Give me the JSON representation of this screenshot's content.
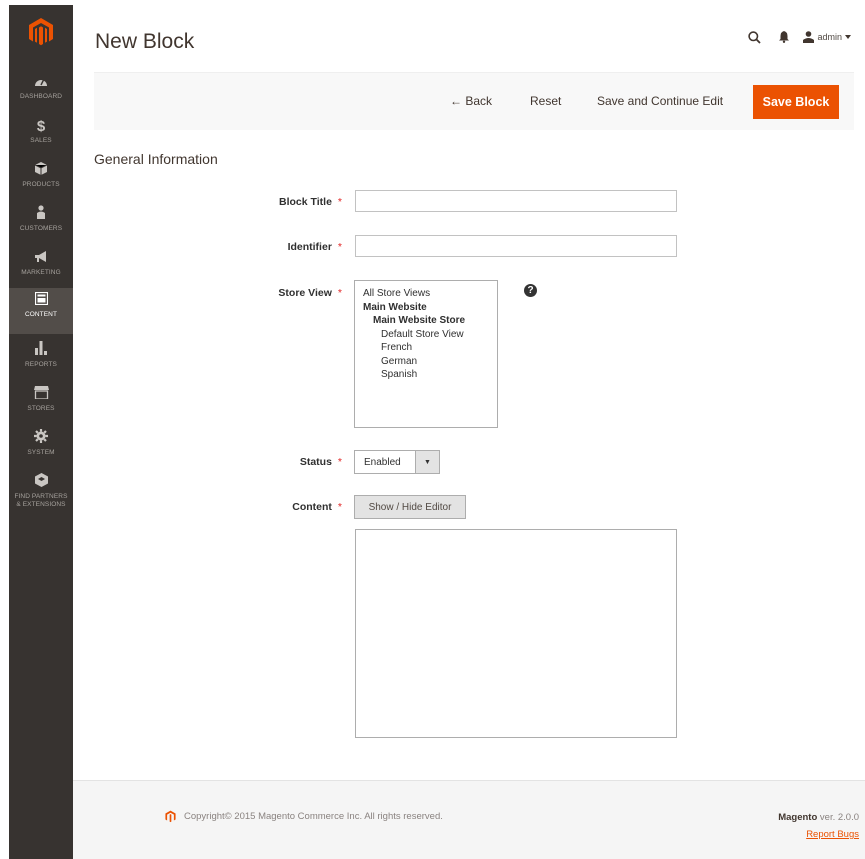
{
  "header": {
    "page_title": "New Block",
    "admin_user": "admin"
  },
  "sidebar": {
    "items": [
      {
        "label": "DASHBOARD",
        "icon": "dashboard-icon"
      },
      {
        "label": "SALES",
        "icon": "dollar-icon"
      },
      {
        "label": "PRODUCTS",
        "icon": "box-icon"
      },
      {
        "label": "CUSTOMERS",
        "icon": "person-icon"
      },
      {
        "label": "MARKETING",
        "icon": "megaphone-icon"
      },
      {
        "label": "CONTENT",
        "icon": "content-icon"
      },
      {
        "label": "REPORTS",
        "icon": "bar-chart-icon"
      },
      {
        "label": "STORES",
        "icon": "store-icon"
      },
      {
        "label": "SYSTEM",
        "icon": "gear-icon"
      },
      {
        "label": "FIND PARTNERS & EXTENSIONS",
        "icon": "cube-icon"
      }
    ],
    "active": "CONTENT"
  },
  "toolbar": {
    "back_label": "← Back",
    "reset_label": "Reset",
    "save_continue_label": "Save and Continue Edit",
    "save_label": "Save Block"
  },
  "form": {
    "section_title": "General Information",
    "block_title_label": "Block Title",
    "block_title_value": "",
    "identifier_label": "Identifier",
    "identifier_value": "",
    "store_view_label": "Store View",
    "store_view_options": [
      "All Store Views",
      "Main Website",
      "Main Website Store",
      "Default Store View",
      "French",
      "German",
      "Spanish"
    ],
    "status_label": "Status",
    "status_value": "Enabled",
    "content_label": "Content",
    "editor_toggle_label": "Show / Hide Editor",
    "content_value": "",
    "required_mark": "*",
    "help_mark": "?"
  },
  "footer": {
    "copyright": "Copyright© 2015 Magento Commerce Inc. All rights reserved.",
    "brand": "Magento",
    "version": "ver. 2.0.0",
    "report_bugs": "Report Bugs"
  },
  "colors": {
    "accent": "#eb5202",
    "sidebar_bg": "#373330",
    "required": "#e22626"
  }
}
